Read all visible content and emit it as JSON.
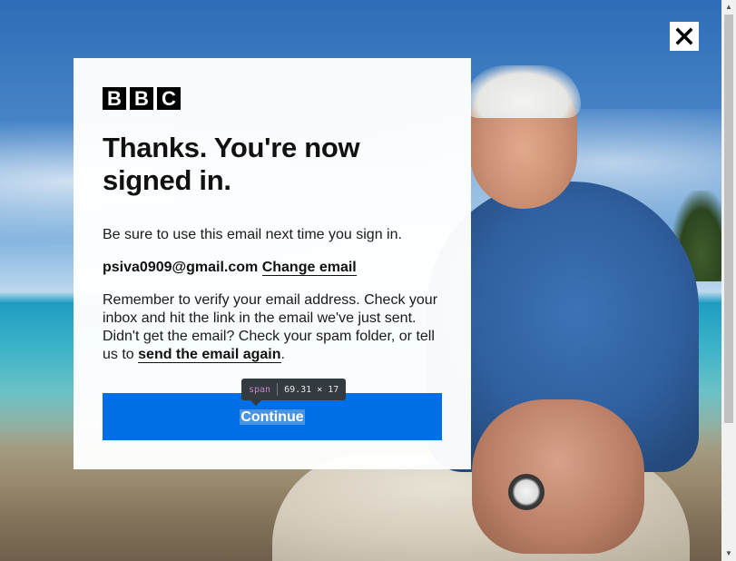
{
  "brand": {
    "logo_letters": [
      "B",
      "B",
      "C"
    ]
  },
  "dialog": {
    "headline": "Thanks. You're now signed in.",
    "intro": "Be sure to use this email next time you sign in.",
    "email": "psiva0909@gmail.com",
    "change_email_label": "Change email",
    "verify_text_before": "Remember to verify your email address. Check your inbox and hit the link in the email we've just sent. Didn't get the email? Check your spam folder, or tell us to ",
    "send_again_label": "send the email again",
    "verify_text_after": ".",
    "continue_label": "Continue"
  },
  "close": {
    "icon": "close-icon"
  },
  "inspector_tooltip": {
    "tag": "span",
    "dimensions": "69.31 × 17"
  },
  "colors": {
    "primary_button": "#006ee6",
    "text": "#111111",
    "modal_bg": "#ffffff"
  }
}
